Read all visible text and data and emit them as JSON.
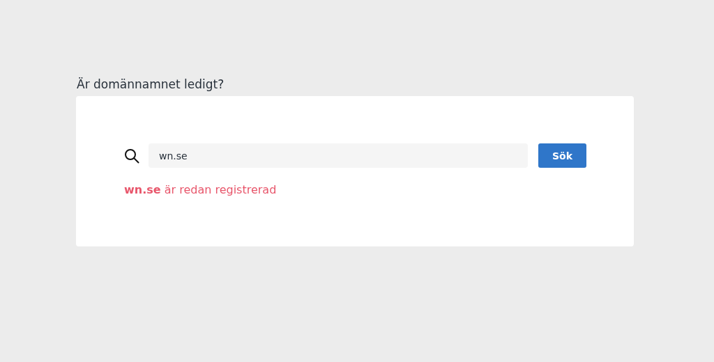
{
  "heading": "Är domännamnet ledigt?",
  "search": {
    "value": "wn.se",
    "button": "Sök"
  },
  "result": "**wn.se** är redan registrerad"
}
